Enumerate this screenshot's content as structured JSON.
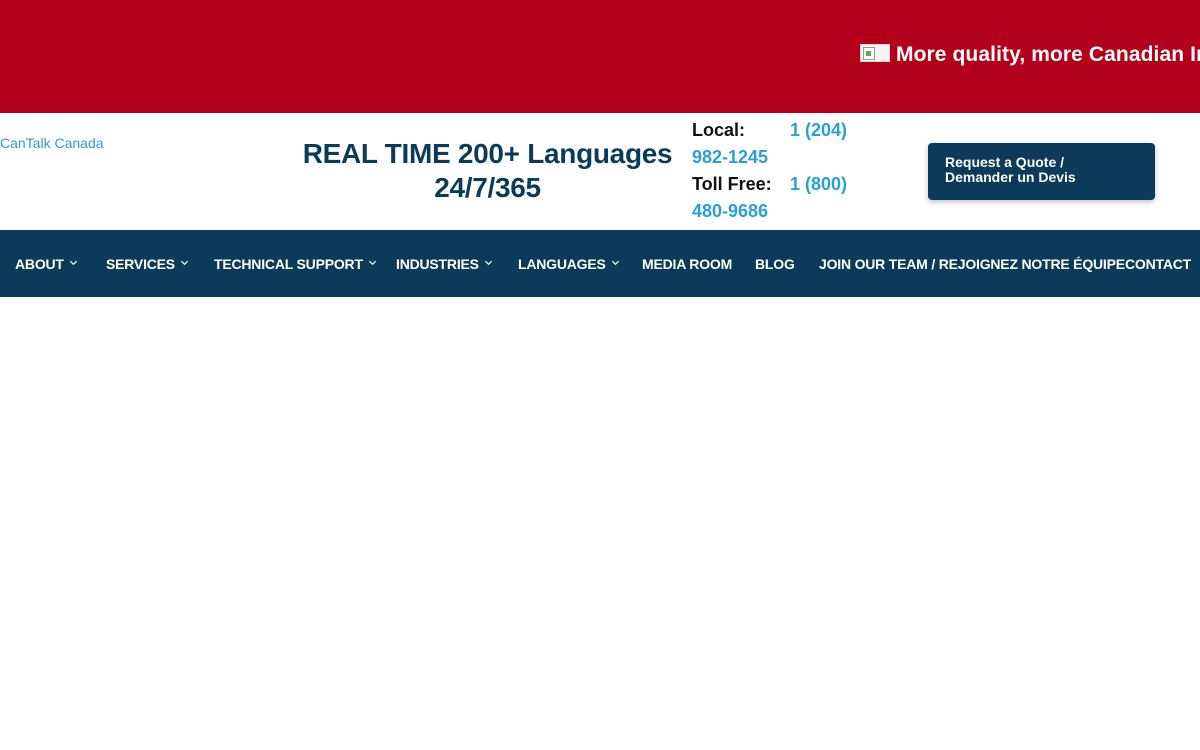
{
  "banner": {
    "text": "More quality, more Canadian In"
  },
  "header": {
    "logo_text": "CanTalk Canada",
    "tagline_line1": "REAL TIME 200+ Languages",
    "tagline_line2": "24/7/365",
    "phones": [
      {
        "label": "Local:",
        "number_part1": "1 (204)",
        "number_part2": "982-1245"
      },
      {
        "label": "Toll Free:",
        "number_part1": "1 (800)",
        "number_part2": "480-9686"
      }
    ],
    "quote_button_line1": "Request a Quote /",
    "quote_button_line2": "Demander un Devis"
  },
  "nav": {
    "items": [
      {
        "label": "ABOUT",
        "has_dropdown": true
      },
      {
        "label": "SERVICES",
        "has_dropdown": true
      },
      {
        "label": "TECHNICAL SUPPORT",
        "has_dropdown": true
      },
      {
        "label": "INDUSTRIES",
        "has_dropdown": true
      },
      {
        "label": "LANGUAGES",
        "has_dropdown": true
      },
      {
        "label": "MEDIA ROOM",
        "has_dropdown": false
      },
      {
        "label": "BLOG",
        "has_dropdown": false
      },
      {
        "label": "JOIN OUR TEAM / REJOIGNEZ NOTRE ÉQUIPE",
        "has_dropdown": false
      },
      {
        "label": "CONTACT",
        "has_dropdown": false
      }
    ]
  },
  "colors": {
    "banner_red": "#b3001b",
    "navy": "#0c3a59",
    "link_blue": "#2a9fd6"
  }
}
